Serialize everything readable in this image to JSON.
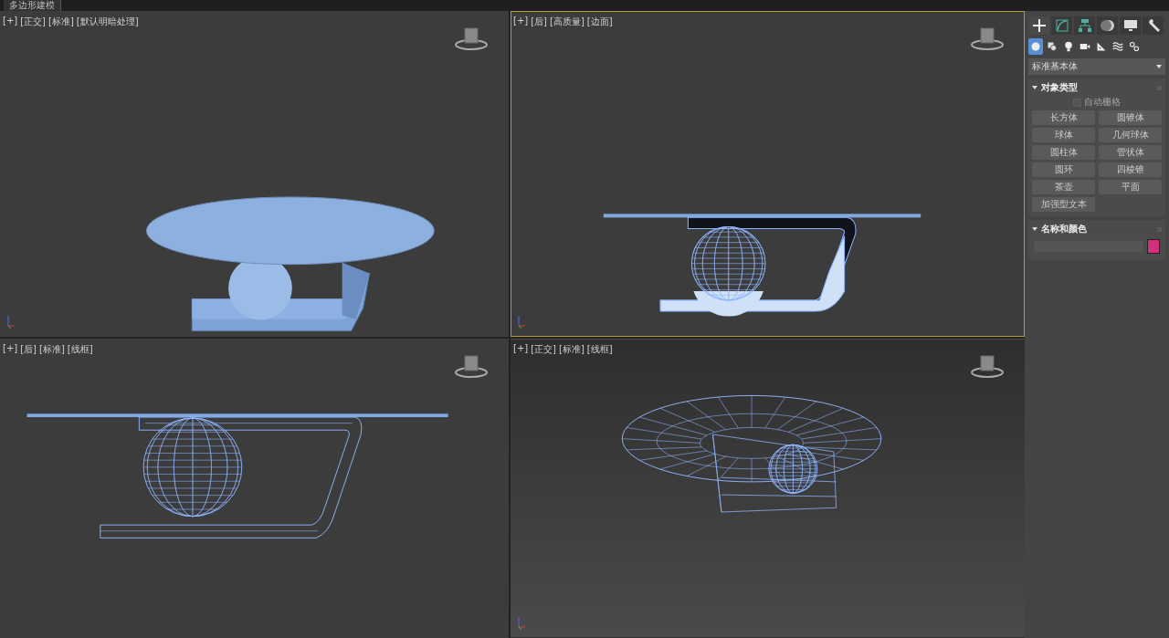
{
  "ribbon_tab": {
    "label": "多边形建模"
  },
  "viewports": [
    {
      "kind": "shaded",
      "selected": false,
      "labels": [
        "[+]",
        "[正交]",
        "[标准]",
        "[默认明暗处理]"
      ]
    },
    {
      "kind": "front",
      "selected": true,
      "labels": [
        "[+]",
        "[后]",
        "[高质量]",
        "[边面]"
      ]
    },
    {
      "kind": "wire",
      "selected": false,
      "labels": [
        "[+]",
        "[后]",
        "[标准]",
        "[线框]"
      ]
    },
    {
      "kind": "perspective",
      "selected": false,
      "labels": [
        "[+]",
        "[正交]",
        "[标准]",
        "[线框]"
      ]
    }
  ],
  "command_panel": {
    "tabs": [
      {
        "selected": true
      },
      {
        "selected": false
      },
      {
        "selected": false
      },
      {
        "selected": false
      },
      {
        "selected": false
      },
      {
        "selected": false
      }
    ],
    "categories": [
      {
        "selected": true
      },
      {
        "selected": false
      },
      {
        "selected": false
      },
      {
        "selected": false
      },
      {
        "selected": false
      },
      {
        "selected": false
      },
      {
        "selected": false
      }
    ],
    "dropdown": "标准基本体",
    "object_type": {
      "title": "对象类型",
      "auto_grid": {
        "label": "自动栅格",
        "checked": false,
        "disabled": true
      },
      "buttons": [
        "长方体",
        "圆锥体",
        "球体",
        "几何球体",
        "圆柱体",
        "管状体",
        "圆环",
        "四棱锥",
        "茶壶",
        "平面",
        "加强型文本"
      ]
    },
    "name_color": {
      "title": "名称和颜色",
      "color": "#d0307f"
    }
  }
}
